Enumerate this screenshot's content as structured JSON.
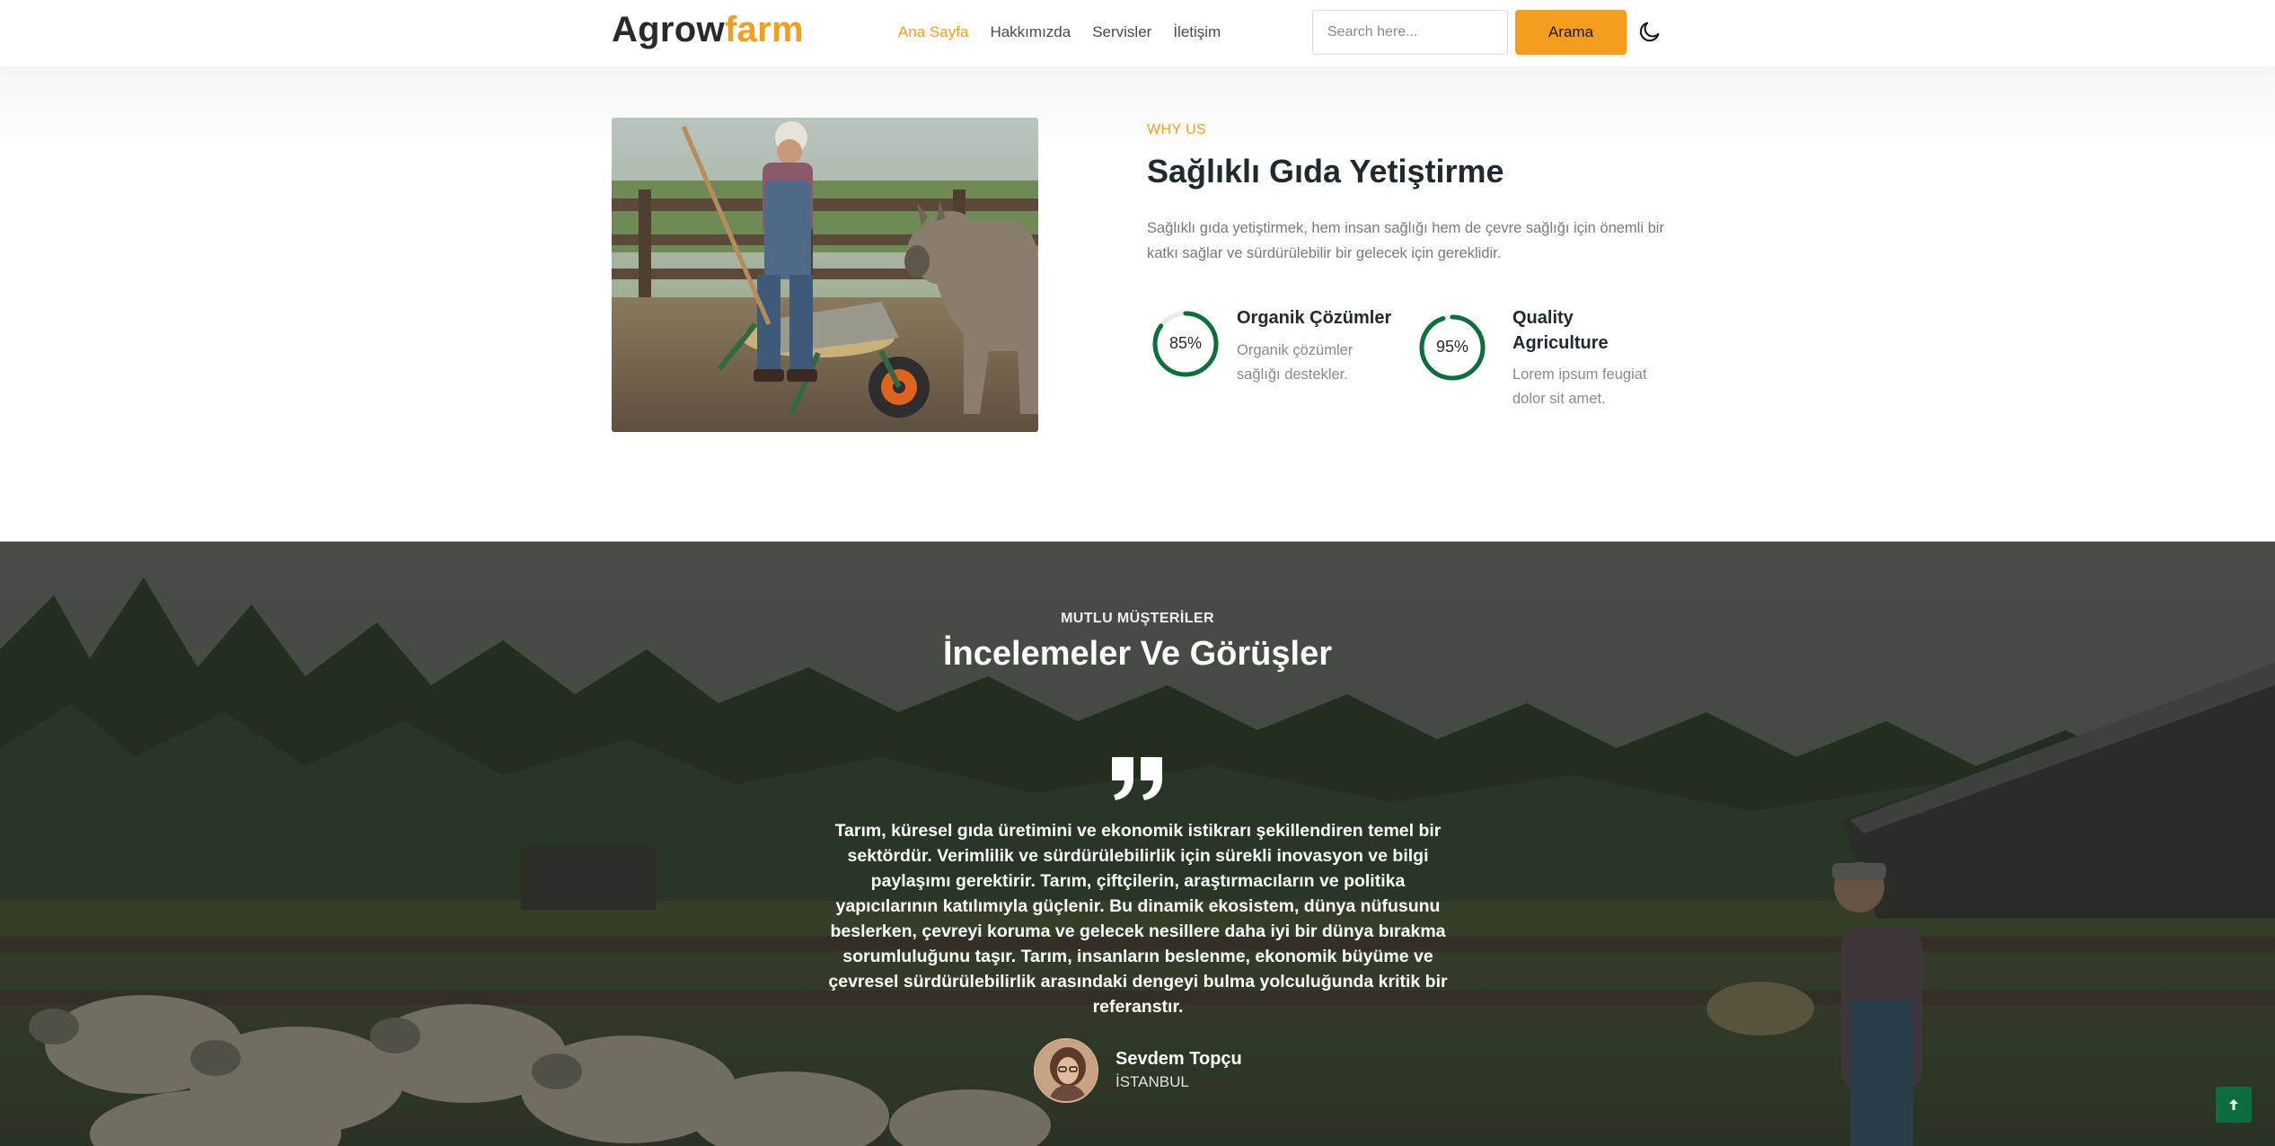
{
  "brand": {
    "name_part1": "Agrow",
    "name_part2": "farm",
    "accent_color": "#f59d1d"
  },
  "nav": {
    "items": [
      {
        "label": "Ana Sayfa",
        "active": true
      },
      {
        "label": "Hakkımızda",
        "active": false
      },
      {
        "label": "Servisler",
        "active": false
      },
      {
        "label": "İletişim",
        "active": false
      }
    ]
  },
  "search": {
    "placeholder": "Search here...",
    "value": "",
    "button_label": "Arama"
  },
  "header_icons": {
    "theme_toggle": "moon-icon"
  },
  "why_us": {
    "eyebrow": "WHY US",
    "title": "Sağlıklı Gıda Yetiştirme",
    "description": "Sağlıklı gıda yetiştirmek, hem insan sağlığı hem de çevre sağlığı için önemli bir katkı sağlar ve sürdürülebilir bir gelecek için gereklidir.",
    "stats": [
      {
        "percent_label": "85%",
        "value": 85,
        "title": "Organik Çözümler",
        "description": "Organik çözümler sağlığı destekler."
      },
      {
        "percent_label": "95%",
        "value": 95,
        "title": "Quality Agriculture",
        "description": "Lorem ipsum feugiat dolor sit amet."
      }
    ],
    "ring_color": "#0b6e3c"
  },
  "testimonials": {
    "eyebrow": "MUTLU MÜŞTERİLER",
    "title": "İncelemeler Ve Görüşler",
    "quote": "Tarım, küresel gıda üretimini ve ekonomik istikrarı şekillendiren temel bir sektördür. Verimlilik ve sürdürülebilirlik için sürekli inovasyon ve bilgi paylaşımı gerektirir. Tarım, çiftçilerin, araştırmacıların ve politika yapıcılarının katılımıyla güçlenir. Bu dinamik ekosistem, dünya nüfusunu beslerken, çevreyi koruma ve gelecek nesillere daha iyi bir dünya bırakma sorumluluğunu taşır. Tarım, insanların beslenme, ekonomik büyüme ve çevresel sürdürülebilirlik arasındaki dengeyi bulma yolculuğunda kritik bir referanstır.",
    "author_name": "Sevdem Topçu",
    "author_city": "İSTANBUL"
  },
  "scroll_top": {
    "icon": "arrow-up-icon",
    "color": "#0b6e3c"
  }
}
